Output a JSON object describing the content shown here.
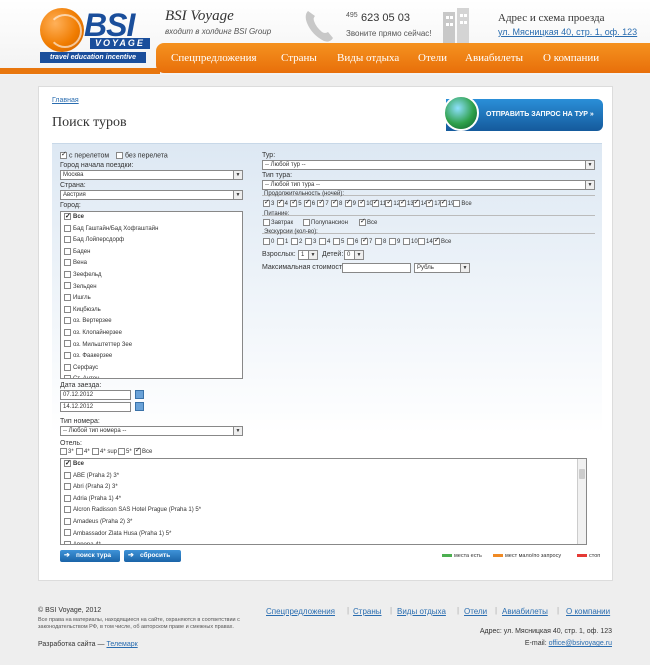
{
  "header": {
    "logo": {
      "bsi": "BSI",
      "voyage": "VOYAGE",
      "tagline": "travel education incentive"
    },
    "brand_title": "BSI Voyage",
    "brand_sub": "входит в холдинг BSI Group",
    "phone_prefix": "495",
    "phone_number": "623 05 03",
    "phone_note": "Звоните прямо сейчас!",
    "address_title": "Адрес и схема проезда",
    "address_link": "ул. Мясницкая 40, стр. 1, оф. 123"
  },
  "nav": {
    "items": [
      "Спецпредложения",
      "Страны",
      "Виды отдыха",
      "Отели",
      "Авиабилеты",
      "О компании"
    ]
  },
  "main": {
    "breadcrumb": "Главная",
    "title": "Поиск туров",
    "send_request": "ОТПРАВИТЬ ЗАПРОС НА ТУР »"
  },
  "form": {
    "with_flight": "с перелетом",
    "without_flight": "без перелета",
    "departure_label": "Город начала поездки:",
    "departure_value": "Москва",
    "country_label": "Страна:",
    "country_value": "Австрия",
    "city_label": "Город:",
    "cities": [
      "Все",
      "Бад Гаштайн/Бад Хофгаштайн",
      "Бад Лойперсдорф",
      "Баден",
      "Вена",
      "Зеефельд",
      "Зельден",
      "Ишгль",
      "Кицбюэль",
      "оз. Вертерзее",
      "оз. Клопайнерзее",
      "оз. Мильштеттер Зее",
      "оз. Фаакерзее",
      "Серфаус",
      "Ст. Антон"
    ],
    "arrival_label": "Дата заезда:",
    "date_from": "07.12.2012",
    "date_to": "14.12.2012",
    "room_type_label": "Тип номера:",
    "room_type_value": "-- Любой тип номера --",
    "hotel_label": "Отель:",
    "stars": [
      "3*",
      "4*",
      "4* sup",
      "5*",
      "Все"
    ],
    "hotels": [
      "Все",
      "ABE (Praha 2) 3*",
      "Abri (Praha 2) 3*",
      "Adria (Praha 1) 4*",
      "Alcron Radisson SAS Hotel Prague (Praha 1) 5*",
      "Amadeus (Praha 2) 3*",
      "Ambassador Zlata Husa (Praha 1) 5*",
      "Аврора 4*"
    ],
    "tour_label": "Тур:",
    "tour_value": "-- Любой тур --",
    "tour_type_label": "Тип тура:",
    "tour_type_value": "-- Любой тип тура --",
    "duration_label": "Продолжительность (ночей):",
    "nights": [
      "3",
      "4",
      "5",
      "6",
      "7",
      "8",
      "9",
      "10",
      "11",
      "12",
      "13",
      "14",
      "17",
      "19",
      "Все"
    ],
    "meal_label": "Питание:",
    "meals": [
      "Завтрак",
      "Полупансион",
      "Все"
    ],
    "excursions_label": "Экскурсии (кол-во):",
    "excursions": [
      "0",
      "1",
      "2",
      "3",
      "4",
      "5",
      "6",
      "7",
      "8",
      "9",
      "10",
      "14",
      "Все"
    ],
    "adults_label": "Взрослых:",
    "adults_value": "1",
    "children_label": "Детей:",
    "children_value": "0",
    "max_price_label": "Максимальная стоимость:",
    "currency_value": "Рубль",
    "search_button": "поиск тура",
    "reset_button": "сбросить",
    "legend": [
      {
        "label": "места есть",
        "color": "#4caf50"
      },
      {
        "label": "мест мало/по запросу",
        "color": "#f08a24"
      },
      {
        "label": "стоп",
        "color": "#e53935"
      }
    ]
  },
  "footer": {
    "copyright": "© BSI Voyage, 2012",
    "note": "Все права на материалы, находящиеся на сайте, охраняются в соответствии с законодательством РФ, в том числе, об авторском праве и смежных правах.",
    "dev_prefix": "Разработка сайта —",
    "dev_link": "Телемарк",
    "nav": [
      "Спецпредложения",
      "Страны",
      "Виды отдыха",
      "Отели",
      "Авиабилеты",
      "О компании"
    ],
    "address": "Адрес: ул. Мясницкая 40, стр. 1, оф. 123",
    "email_prefix": "E-mail:",
    "email": "office@bsivoyage.ru"
  }
}
